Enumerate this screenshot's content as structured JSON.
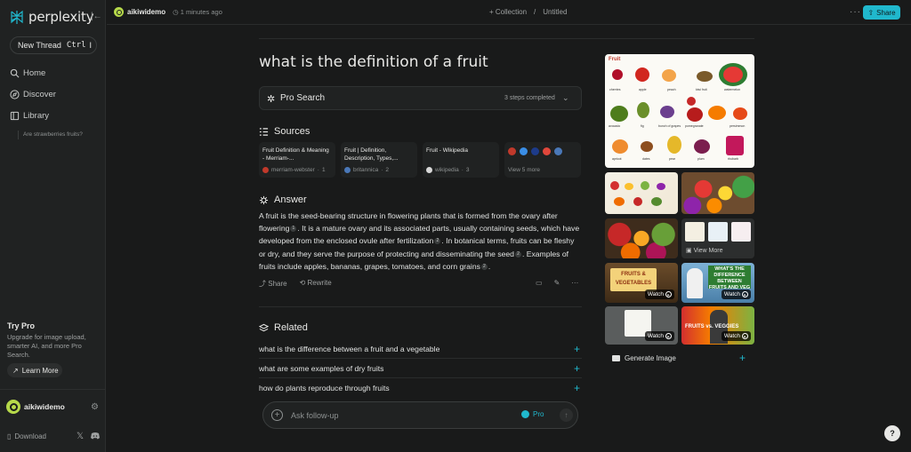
{
  "sidebar": {
    "logo": "perplexity",
    "new_thread": "New Thread",
    "shortcut_ctrl": "Ctrl",
    "shortcut_key": "I",
    "nav": [
      "Home",
      "Discover",
      "Library"
    ],
    "library_items": [
      "Are strawberries fruits?"
    ],
    "try_pro_title": "Try Pro",
    "try_pro_text": "Upgrade for image upload, smarter AI, and more Pro Search.",
    "learn_more": "Learn More",
    "username": "aikiwidemo",
    "download": "Download"
  },
  "topbar": {
    "username": "aikiwidemo",
    "time": "1 minutes ago",
    "collection": "+ Collection",
    "separator": "/",
    "title": "Untitled",
    "share": "Share"
  },
  "thread": {
    "question": "what is the definition of a fruit",
    "pro_search": {
      "label": "Pro Search",
      "steps": "3 steps completed"
    },
    "sources_heading": "Sources",
    "sources": [
      {
        "title": "Fruit Definition & Meaning - Merriam-...",
        "site": "merriam-webster",
        "num": "1",
        "color": "#c0392b"
      },
      {
        "title": "Fruit | Definition, Description, Types,...",
        "site": "britannica",
        "num": "2",
        "color": "#4a78b8"
      },
      {
        "title": "Fruit - Wikipedia",
        "site": "wikipedia",
        "num": "3",
        "color": "#d8d8d8"
      }
    ],
    "view_more": "View 5 more",
    "answer_heading": "Answer",
    "answer": {
      "s1": "A fruit is the seed-bearing structure in flowering plants that is formed from the ovary after flowering",
      "c1": "1",
      "s2": ". It is a mature ovary and its associated parts, usually containing seeds, which have developed from the enclosed ovule after fertilization",
      "c2": "2",
      "s3": ". In botanical terms, fruits can be fleshy or dry, and they serve the purpose of protecting and disseminating the seed",
      "c3": "2",
      "s4": ". Examples of fruits include apples, bananas, grapes, tomatoes, and corn grains",
      "c4": "2",
      "s5": "."
    },
    "actions": {
      "share": "Share",
      "rewrite": "Rewrite"
    },
    "related_heading": "Related",
    "related": [
      "what is the difference between a fruit and a vegetable",
      "what are some examples of dry fruits",
      "how do plants reproduce through fruits"
    ],
    "followup_placeholder": "Ask follow-up",
    "pro_label": "Pro"
  },
  "media": {
    "main_image_title": "Fruit",
    "main_labels": [
      "cherries",
      "apple",
      "peach",
      "kiwi fruit",
      "watermelon",
      "lychee",
      "avocado",
      "fig",
      "bunch of grapes",
      "pomegranate",
      "persimmon",
      "apricot",
      "dates",
      "pear",
      "plum",
      "rhubarb"
    ],
    "view_more": "View More",
    "video1_text": "FRUITS & VEGETABLES",
    "video2_text": "WHAT'S THE DIFFERENCE BETWEEN FRUITS AND VEG",
    "video4_text": "FRUITS vs. VEGGIES",
    "watch": "Watch",
    "generate_image": "Generate Image"
  },
  "colors": {
    "accent": "#20b8cd",
    "background": "#191a1a",
    "sidebar": "#202222"
  }
}
